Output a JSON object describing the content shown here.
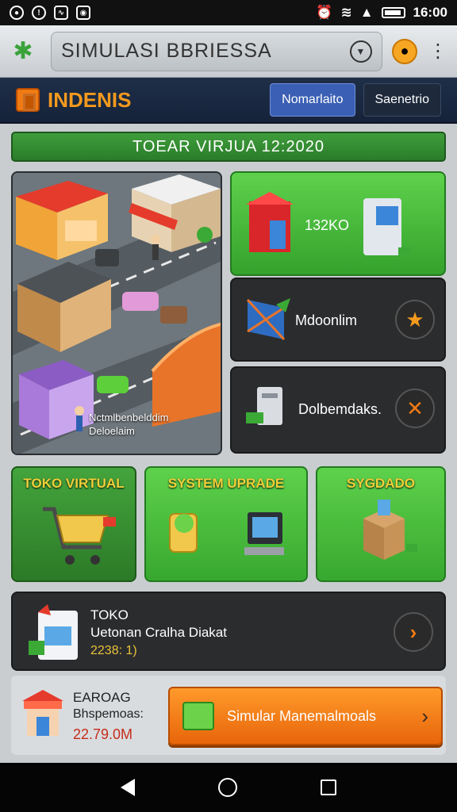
{
  "statusbar": {
    "time": "16:00"
  },
  "appbar": {
    "url": "SIMULASI BBRIESSA"
  },
  "header": {
    "brand": "INDENIS",
    "tab_primary": "Nomarlaito",
    "tab_secondary": "Saenetrio"
  },
  "banner": {
    "text": "TOEAR VIRJUA 12:2020"
  },
  "map": {
    "caption_line1": "Nctmlbenbelddim",
    "caption_line2": "Deloelaim"
  },
  "cards": {
    "card1_value": "132KO",
    "card2_label": "Mdoonlim",
    "card3_label": "Dolbemdaks."
  },
  "tiles": [
    {
      "title": "TOKO VIRTUAL"
    },
    {
      "title": "SYSTEM UPRADE"
    },
    {
      "title": "SYGDADO"
    }
  ],
  "toko": {
    "title": "TOKO",
    "subtitle": "Uetonan Cralha Diakat",
    "number": "2238: 1)"
  },
  "bottom": {
    "title": "EAROAG",
    "subtitle": "Bhspemoas:",
    "value": "22.79.0M",
    "button": "Simular Manemalmoals"
  },
  "colors": {
    "accent_green": "#4cbf3f",
    "accent_orange": "#f07b14",
    "header_blue": "#1f2f48"
  }
}
